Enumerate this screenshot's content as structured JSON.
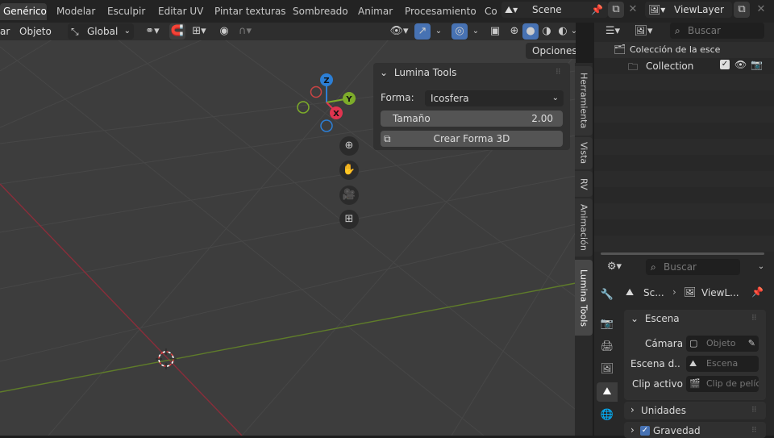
{
  "workspace_tabs": [
    "Genérico",
    "Modelar",
    "Esculpir",
    "Editar UV",
    "Pintar texturas",
    "Sombreado",
    "Animar",
    "Procesamiento",
    "Co"
  ],
  "scene": {
    "name": "Scene",
    "view_layer": "ViewLayer"
  },
  "viewport_header": {
    "menu_items": [
      "ar",
      "Objeto"
    ],
    "orientation": "Global",
    "options_label": "Opciones"
  },
  "gizmo": {
    "axes": [
      "Z",
      "Y",
      "X"
    ]
  },
  "side_tabs": [
    "Herramienta",
    "Vista",
    "RV",
    "Animación",
    "Lumina Tools"
  ],
  "lumina": {
    "title": "Lumina Tools",
    "shape_label": "Forma:",
    "shape_value": "Icosfera",
    "size_label": "Tamaño",
    "size_value": "2.00",
    "create_button": "Crear Forma 3D"
  },
  "outliner": {
    "search_placeholder": "Buscar",
    "scene_collection": "Colección de la esce",
    "collection": "Collection"
  },
  "properties": {
    "search_placeholder": "Buscar",
    "breadcrumb_scene": "Sc...",
    "breadcrumb_layer": "ViewL...",
    "section_scene": "Escena",
    "camera_label": "Cámara",
    "camera_placeholder": "Objeto",
    "bg_scene_label": "Escena d...",
    "bg_scene_placeholder": "Escena",
    "clip_label": "Clip activo",
    "clip_placeholder": "Clip de pelíc",
    "units": "Unidades",
    "gravity": "Gravedad"
  },
  "colors": {
    "x_axis": "#e0344f",
    "y_axis": "#7dac2a",
    "z_axis": "#2c7fd6",
    "accent": "#4772b3"
  }
}
